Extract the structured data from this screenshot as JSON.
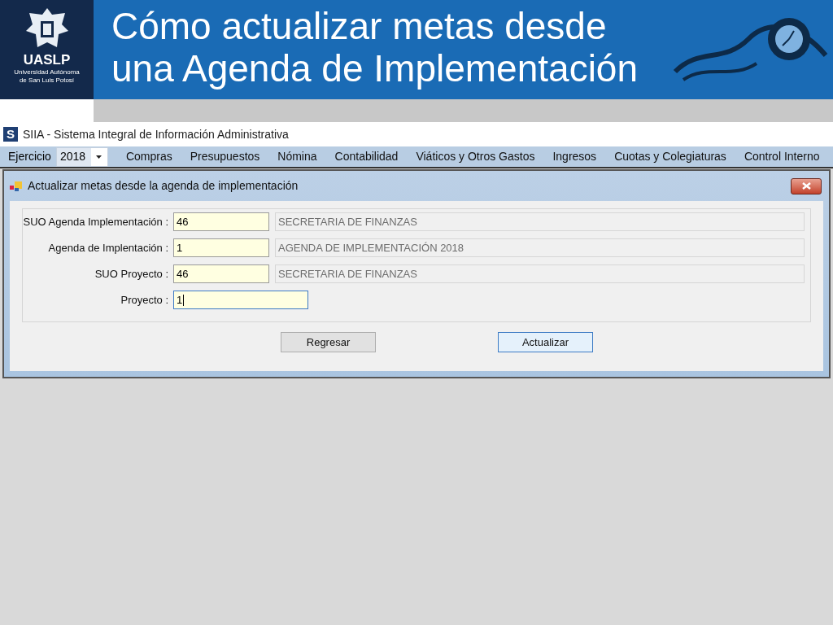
{
  "slide": {
    "title_lines": [
      "Cómo actualizar metas desde",
      "una Agenda de Implementación"
    ],
    "logo": {
      "name": "UASLP",
      "lines": [
        "Universidad Autónoma",
        "de San Luis Potosí"
      ]
    }
  },
  "app": {
    "title": "SIIA - Sistema Integral de Información Administrativa",
    "logo_letter": "S",
    "menu": {
      "year_label": "Ejercicio",
      "year_value": "2018",
      "items": [
        "Compras",
        "Presupuestos",
        "Nómina",
        "Contabilidad",
        "Viáticos y Otros Gastos",
        "Ingresos",
        "Cuotas y Colegiaturas",
        "Control Interno"
      ]
    }
  },
  "dialog": {
    "title": "Actualizar metas desde la agenda de implementación",
    "fields": [
      {
        "label": "SUO Agenda Implementación :",
        "value": "46",
        "description": "SECRETARIA DE FINANZAS",
        "focused": false
      },
      {
        "label": "Agenda de Implentación :",
        "value": "1",
        "description": "AGENDA DE IMPLEMENTACIÓN 2018",
        "focused": false
      },
      {
        "label": "SUO Proyecto :",
        "value": "46",
        "description": "SECRETARIA DE FINANZAS",
        "focused": false
      },
      {
        "label": "Proyecto :",
        "value": "1",
        "focused": true
      }
    ],
    "buttons": [
      {
        "label": "Regresar",
        "default": false
      },
      {
        "label": "Actualizar",
        "default": true
      }
    ]
  }
}
